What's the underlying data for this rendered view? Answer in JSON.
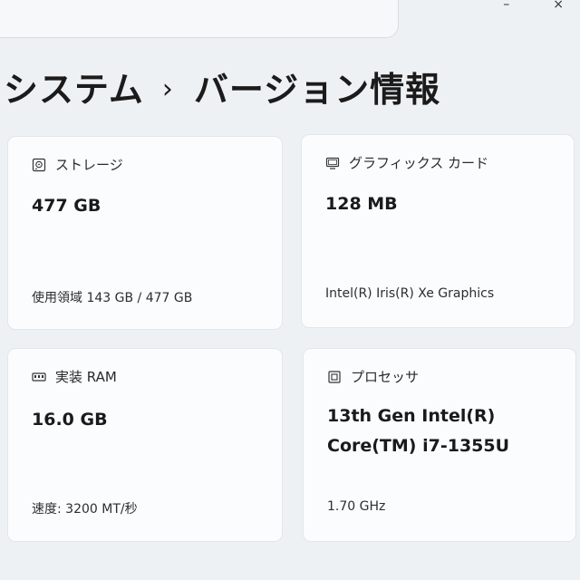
{
  "window": {
    "minimize_glyph": "–",
    "close_glyph": "×"
  },
  "breadcrumb": {
    "parent": "システム",
    "separator": "›",
    "current": "バージョン情報"
  },
  "cards": [
    {
      "title": "ストレージ",
      "icon": "hard-drive-icon",
      "value": "477 GB",
      "detail": "使用領域 143 GB / 477 GB"
    },
    {
      "title": "グラフィックス カード",
      "icon": "display-icon",
      "value": "128 MB",
      "detail": "Intel(R) Iris(R) Xe Graphics"
    },
    {
      "title": "実装 RAM",
      "icon": "memory-icon",
      "value": "16.0 GB",
      "detail": "速度: 3200 MT/秒"
    },
    {
      "title": "プロセッサ",
      "icon": "processor-icon",
      "value": "13th Gen Intel(R) Core(TM) i7-1355U",
      "detail": "1.70 GHz"
    }
  ]
}
